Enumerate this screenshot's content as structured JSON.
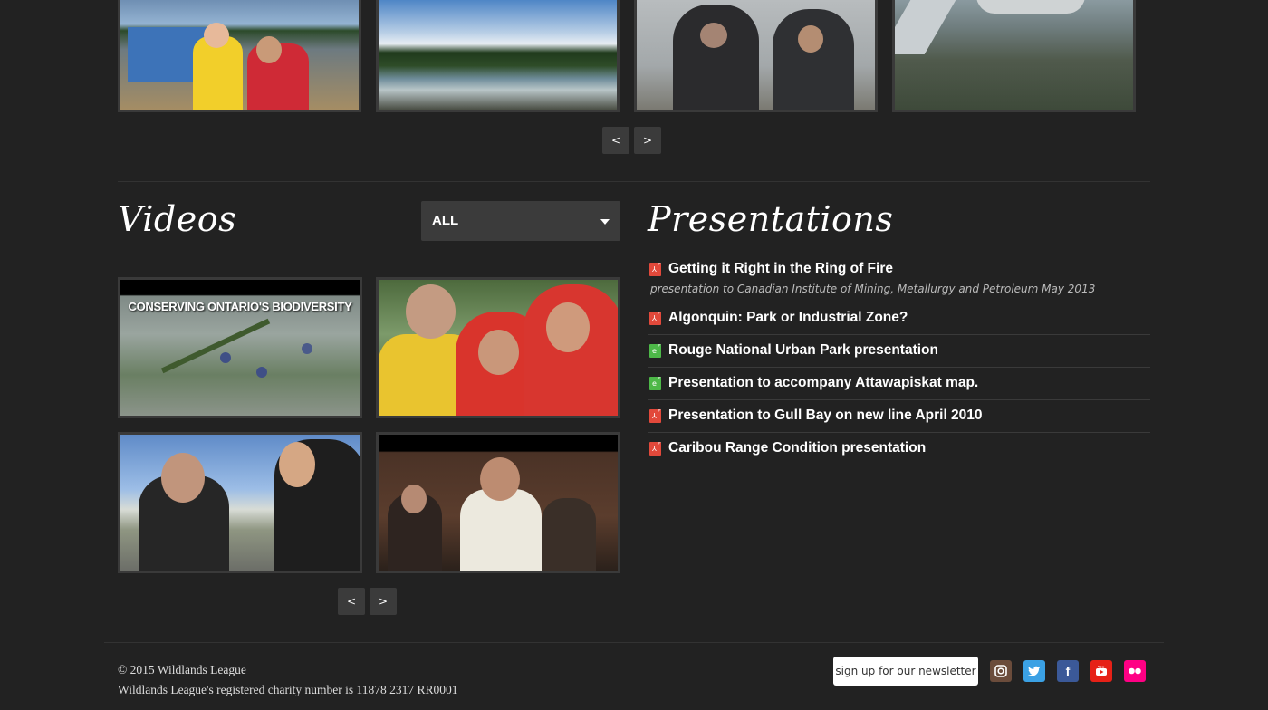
{
  "photos_pager": {
    "prev": "<",
    "next": ">"
  },
  "videos": {
    "title": "Videos",
    "filter_value": "ALL",
    "thumbnail_caption": "CONSERVING ONTARIO'S BIODIVERSITY",
    "pager": {
      "prev": "<",
      "next": ">"
    }
  },
  "presentations": {
    "title": "Presentations",
    "items": [
      {
        "label": "Getting it Right in the Ring of Fire",
        "icon": "pdf-icon",
        "sub": "presentation to Canadian Institute of Mining, Metallurgy and Petroleum May 2013"
      },
      {
        "label": "Algonquin: Park or Industrial Zone?",
        "icon": "pdf-icon"
      },
      {
        "label": "Rouge National Urban Park presentation",
        "icon": "web-document-icon"
      },
      {
        "label": "Presentation to accompany Attawapiskat map.",
        "icon": "web-document-icon"
      },
      {
        "label": "Presentation to Gull Bay on new line April 2010",
        "icon": "pdf-icon"
      },
      {
        "label": "Caribou Range Condition presentation",
        "icon": "pdf-icon"
      }
    ]
  },
  "footer": {
    "copyright": "© 2015 Wildlands League",
    "charity": "Wildlands League's registered charity number is 11878 2317 RR0001",
    "newsletter": "sign up for our newsletter"
  },
  "colors": {
    "background": "#222222",
    "pdf": "#e2493b",
    "web": "#4db848",
    "instagram": "#6b4c3b",
    "twitter": "#3ba1e4",
    "facebook": "#3b5998",
    "youtube": "#e62117",
    "flickr": "#ff0084"
  }
}
